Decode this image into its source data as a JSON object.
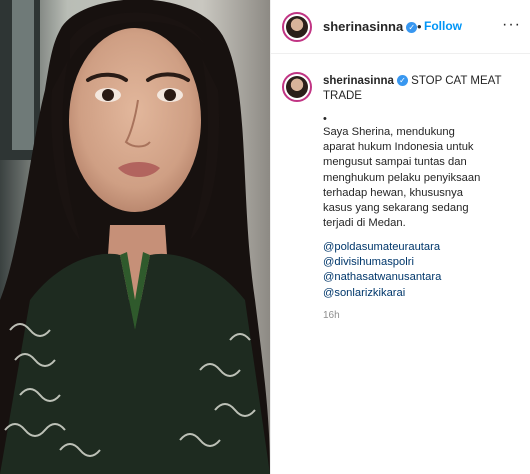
{
  "post": {
    "username": "sherinasinna",
    "verified_mark": "✓",
    "separator": "•",
    "follow_label": "Follow",
    "more_label": "···"
  },
  "caption": {
    "username": "sherinasinna",
    "headline": "STOP CAT MEAT TRADE",
    "bullet": "•",
    "body": "Saya Sherina, mendukung aparat hukum Indonesia untuk mengusut sampai tuntas dan menghukum pelaku penyiksaan terhadap hewan, khususnya kasus yang sekarang sedang terjadi di Medan.",
    "mentions": [
      "@poldasumateurautara",
      "@divisihumaspolri",
      "@nathasatwanusantara",
      "@sonlarizkikarai"
    ],
    "timestamp": "16h"
  },
  "colors": {
    "accent_link": "#0095f6",
    "mention": "#00376b",
    "verified": "#3897f0"
  }
}
